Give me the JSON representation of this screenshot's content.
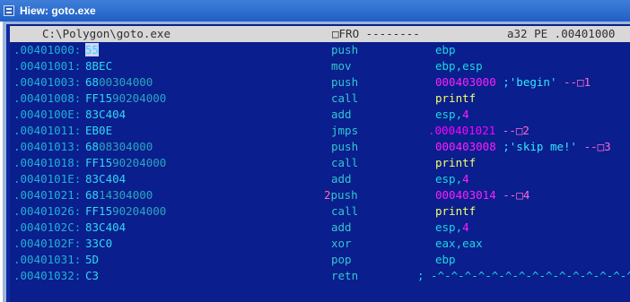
{
  "window": {
    "title": "Hiew: goto.exe"
  },
  "status": {
    "path": "C:\\Polygon\\goto.exe",
    "mode": "□FRO --------",
    "info": "a32 PE .00401000"
  },
  "rows": [
    {
      "addr": ".00401000:",
      "b1": "55",
      "b2": "",
      "mnem": "push",
      "opnd": [
        [
          "",
          "ebp"
        ]
      ]
    },
    {
      "addr": ".00401001:",
      "b1": "8BEC",
      "b2": "",
      "mnem": "mov",
      "opnd": [
        [
          "",
          "ebp,esp"
        ]
      ]
    },
    {
      "addr": ".00401003:",
      "b1": "68",
      "b2": "00304000",
      "mnem": "push",
      "opnd": [
        [
          "imm",
          "000403000"
        ],
        [
          "str",
          " ;'begin'"
        ],
        [
          "ref",
          " --□1"
        ]
      ]
    },
    {
      "addr": ".00401008:",
      "b1": "FF15",
      "b2": "90204000",
      "mnem": "call",
      "opnd": [
        [
          "sym",
          "printf"
        ]
      ]
    },
    {
      "addr": ".0040100E:",
      "b1": "83C404",
      "b2": "",
      "mnem": "add",
      "opnd": [
        [
          "",
          "esp,"
        ],
        [
          "imm",
          "4"
        ]
      ]
    },
    {
      "addr": ".00401011:",
      "b1": "EB0E",
      "b2": "",
      "mnem": "jmps",
      "opnd": [
        [
          "lbl",
          ".000401021"
        ],
        [
          "ref",
          " --□2"
        ]
      ]
    },
    {
      "addr": ".00401013:",
      "b1": "68",
      "b2": "08304000",
      "mnem": "push",
      "opnd": [
        [
          "imm",
          "000403008"
        ],
        [
          "str",
          " ;'skip me!'"
        ],
        [
          "ref",
          " --□3"
        ]
      ]
    },
    {
      "addr": ".00401018:",
      "b1": "FF15",
      "b2": "90204000",
      "mnem": "call",
      "opnd": [
        [
          "sym",
          "printf"
        ]
      ]
    },
    {
      "addr": ".0040101E:",
      "b1": "83C404",
      "b2": "",
      "mnem": "add",
      "opnd": [
        [
          "",
          "esp,"
        ],
        [
          "imm",
          "4"
        ]
      ]
    },
    {
      "addr": ".00401021:",
      "b1": "68",
      "b2": "14304000",
      "mnem": "push",
      "mnem_prefix": "2",
      "opnd": [
        [
          "imm",
          "000403014"
        ],
        [
          "ref",
          " --□4"
        ]
      ]
    },
    {
      "addr": ".00401026:",
      "b1": "FF15",
      "b2": "90204000",
      "mnem": "call",
      "opnd": [
        [
          "sym",
          "printf"
        ]
      ]
    },
    {
      "addr": ".0040102C:",
      "b1": "83C404",
      "b2": "",
      "mnem": "add",
      "opnd": [
        [
          "",
          "esp,"
        ],
        [
          "imm",
          "4"
        ]
      ]
    },
    {
      "addr": ".0040102F:",
      "b1": "33C0",
      "b2": "",
      "mnem": "xor",
      "opnd": [
        [
          "",
          "eax,eax"
        ]
      ]
    },
    {
      "addr": ".00401031:",
      "b1": "5D",
      "b2": "",
      "mnem": "pop",
      "opnd": [
        [
          "",
          "ebp"
        ]
      ]
    },
    {
      "addr": ".00401032:",
      "b1": "C3",
      "b2": "",
      "mnem": "retn",
      "opnd": [
        [
          "",
          "; -^-^-^-^-^-^-^-^-^-^-^-^-^-^-^-"
        ]
      ]
    }
  ],
  "colors": {
    "background": "#0a1e8e",
    "status_bg": "#d8d8d8",
    "address": "#21b1d4",
    "immediate": "#ff1fff",
    "string": "#33e6ff",
    "symbol": "#f5ff66"
  }
}
